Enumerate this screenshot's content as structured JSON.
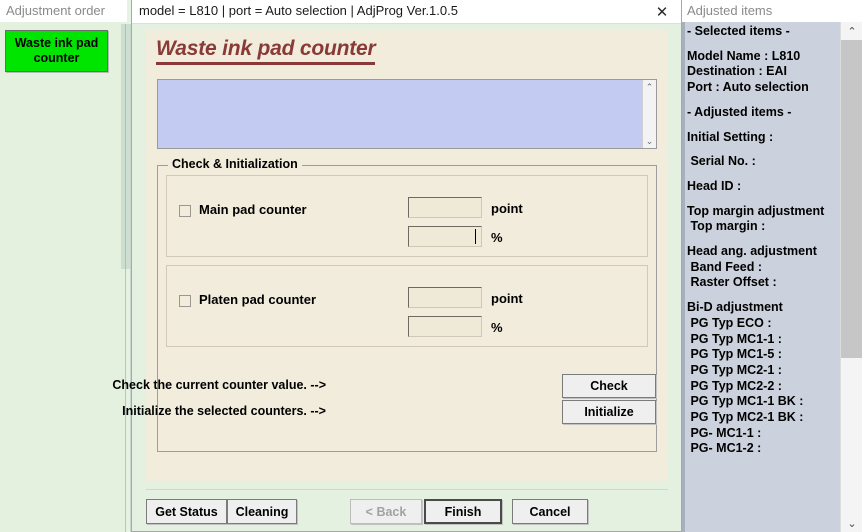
{
  "left_panel": {
    "header": "Adjustment order",
    "button_label": "Waste ink pad\ncounter"
  },
  "dialog": {
    "title": "model = L810 | port = Auto selection | AdjProg Ver.1.0.5",
    "close_icon": "✕",
    "page_title": "Waste ink pad counter",
    "message_text": "",
    "scroll_up_icon": "⌃",
    "scroll_down_icon": "⌄",
    "group": {
      "legend": "Check & Initialization",
      "rows": [
        {
          "checkbox_label": "Main pad counter",
          "point_value": "",
          "point_unit": "point",
          "percent_value": "",
          "percent_unit": "%"
        },
        {
          "checkbox_label": "Platen pad counter",
          "point_value": "",
          "point_unit": "point",
          "percent_value": "",
          "percent_unit": "%"
        }
      ]
    },
    "actions": [
      {
        "text": "Check the current counter value. -->",
        "button": "Check"
      },
      {
        "text": "Initialize the selected counters. -->",
        "button": "Initialize"
      }
    ],
    "footer": {
      "get_status": "Get Status",
      "cleaning": "Cleaning",
      "back": "< Back",
      "finish": "Finish",
      "cancel": "Cancel"
    }
  },
  "right_panel": {
    "header": "Adjusted items",
    "scroll_up_icon": "⌃",
    "scroll_down_icon": "⌄",
    "lines": [
      "- Selected items -",
      "",
      "Model Name : L810",
      "Destination : EAI",
      "Port : Auto selection",
      "",
      "- Adjusted items -",
      "",
      "Initial Setting :",
      "",
      " Serial No. :",
      "",
      "Head ID :",
      "",
      "Top margin adjustment",
      " Top margin :",
      "",
      "Head ang. adjustment",
      " Band Feed :",
      " Raster Offset :",
      "",
      "Bi-D adjustment",
      " PG Typ ECO :",
      " PG Typ MC1-1 :",
      " PG Typ MC1-5 :",
      " PG Typ MC2-1 :",
      " PG Typ MC2-2 :",
      " PG Typ MC1-1 BK :",
      " PG Typ MC2-1 BK :",
      " PG- MC1-1 :",
      " PG- MC1-2 :"
    ]
  },
  "colors": {
    "accent_title": "#8a3a36",
    "highlight_button": "#00e500",
    "dialog_body": "#f1ecdb",
    "dialog_chrome": "#e4f0e0",
    "message_box": "#c3cbf2",
    "right_panel_bg": "#ccd2dd"
  }
}
